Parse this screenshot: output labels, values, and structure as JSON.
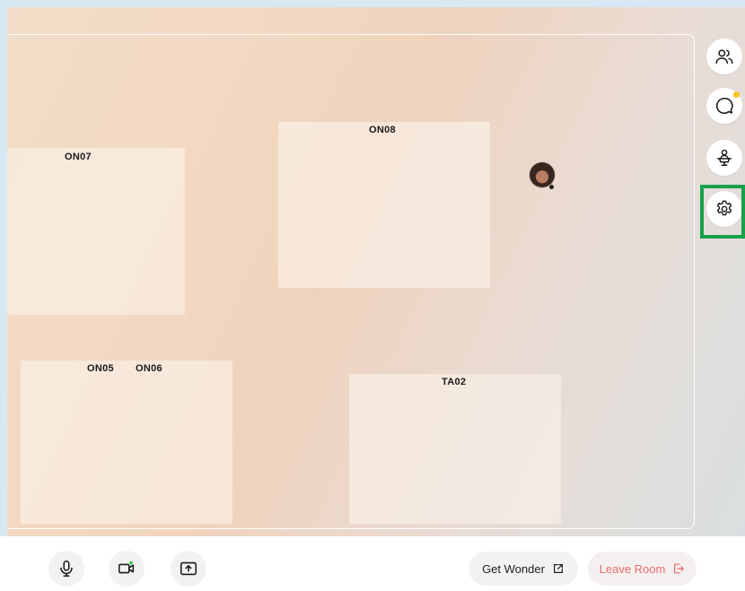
{
  "rooms": [
    {
      "id": "on07",
      "labels": [
        "ON07"
      ]
    },
    {
      "id": "on08",
      "labels": [
        "ON08"
      ]
    },
    {
      "id": "on05-on06",
      "labels": [
        "ON05",
        "ON06"
      ]
    },
    {
      "id": "ta02",
      "labels": [
        "TA02"
      ]
    }
  ],
  "sidebar": {
    "items": [
      {
        "name": "people",
        "icon": "people-icon"
      },
      {
        "name": "chat",
        "icon": "chat-bubble-icon",
        "has_notification": true
      },
      {
        "name": "host",
        "icon": "podium-icon"
      },
      {
        "name": "settings",
        "icon": "gear-icon",
        "highlighted": true
      }
    ]
  },
  "controls": {
    "mic_icon": "microphone-icon",
    "camera_icon": "camera-icon",
    "share_icon": "screen-share-icon"
  },
  "actions": {
    "get_wonder_label": "Get Wonder",
    "leave_room_label": "Leave Room"
  },
  "colors": {
    "highlight": "#18a04a",
    "notification": "#f5c518",
    "camera_active": "#2ecc40",
    "leave": "#ea6a6a"
  }
}
